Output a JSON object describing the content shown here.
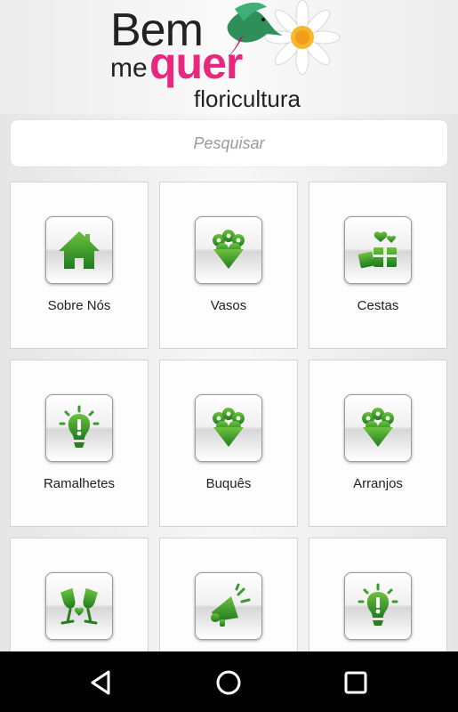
{
  "logo": {
    "line1": "Bem",
    "line2_me": "me",
    "line2_quer": "quer",
    "line3": "floricultura"
  },
  "search": {
    "placeholder": "Pesquisar"
  },
  "menu": [
    {
      "label": "Sobre Nós",
      "icon": "house-icon"
    },
    {
      "label": "Vasos",
      "icon": "bouquet-icon"
    },
    {
      "label": "Cestas",
      "icon": "gifts-icon"
    },
    {
      "label": "Ramalhetes",
      "icon": "lightbulb-icon"
    },
    {
      "label": "Buquês",
      "icon": "bouquet-icon"
    },
    {
      "label": "Arranjos",
      "icon": "bouquet-icon"
    },
    {
      "label": "",
      "icon": "champagne-glasses-icon"
    },
    {
      "label": "",
      "icon": "megaphone-icon"
    },
    {
      "label": "",
      "icon": "lightbulb-icon"
    }
  ],
  "colors": {
    "icon_green": "#3a9a2a",
    "logo_pink": "#e8287f"
  },
  "navbar": {
    "icons": [
      "back-icon",
      "home-icon",
      "recents-icon"
    ]
  }
}
